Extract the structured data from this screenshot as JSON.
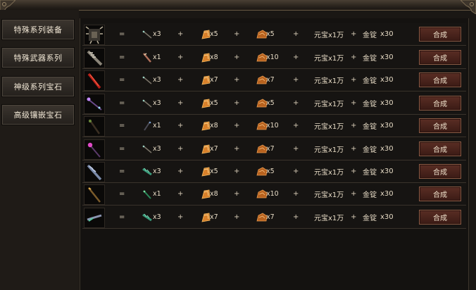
{
  "sidebar": {
    "categories": [
      {
        "label": "特殊系列装备"
      },
      {
        "label": "特殊武器系列"
      },
      {
        "label": "神级系列宝石"
      },
      {
        "label": "高级镶嵌宝石"
      }
    ]
  },
  "recipes": [
    {
      "item_icon": "spiked-armor-icon",
      "equals": "=",
      "mat1_icon": "wand-icon",
      "mat1_qty": "x3",
      "plus1": "+",
      "mat2_icon": "gold-ore-icon",
      "mat2_qty": "x5",
      "plus2": "+",
      "mat3_icon": "copper-ore-icon",
      "mat3_qty": "x5",
      "plus3": "+",
      "yuanbao": "元宝x1万",
      "plus4": "+",
      "gold": "金锭",
      "gold_qty": "x30",
      "button": "合成"
    },
    {
      "item_icon": "heavy-mace-icon",
      "equals": "=",
      "mat1_icon": "short-sword-icon",
      "mat1_qty": "x1",
      "plus1": "+",
      "mat2_icon": "gold-ore-icon",
      "mat2_qty": "x8",
      "plus2": "+",
      "mat3_icon": "copper-ore-icon",
      "mat3_qty": "x10",
      "plus3": "+",
      "yuanbao": "元宝x1万",
      "plus4": "+",
      "gold": "金锭",
      "gold_qty": "x30",
      "button": "合成"
    },
    {
      "item_icon": "red-blade-icon",
      "equals": "=",
      "mat1_icon": "wand-icon",
      "mat1_qty": "x3",
      "plus1": "+",
      "mat2_icon": "gold-ore-icon",
      "mat2_qty": "x7",
      "plus2": "+",
      "mat3_icon": "copper-ore-icon",
      "mat3_qty": "x7",
      "plus3": "+",
      "yuanbao": "元宝x1万",
      "plus4": "+",
      "gold": "金锭",
      "gold_qty": "x30",
      "button": "合成"
    },
    {
      "item_icon": "crystal-staff-icon",
      "equals": "=",
      "mat1_icon": "wand-icon",
      "mat1_qty": "x3",
      "plus1": "+",
      "mat2_icon": "gold-ore-icon",
      "mat2_qty": "x5",
      "plus2": "+",
      "mat3_icon": "copper-ore-icon",
      "mat3_qty": "x5",
      "plus3": "+",
      "yuanbao": "元宝x1万",
      "plus4": "+",
      "gold": "金锭",
      "gold_qty": "x30",
      "button": "合成"
    },
    {
      "item_icon": "dark-spear-icon",
      "equals": "=",
      "mat1_icon": "dark-wand-icon",
      "mat1_qty": "x1",
      "plus1": "+",
      "mat2_icon": "gold-ore-icon",
      "mat2_qty": "x8",
      "plus2": "+",
      "mat3_icon": "copper-ore-icon",
      "mat3_qty": "x10",
      "plus3": "+",
      "yuanbao": "元宝x1万",
      "plus4": "+",
      "gold": "金锭",
      "gold_qty": "x30",
      "button": "合成"
    },
    {
      "item_icon": "pink-orb-staff-icon",
      "equals": "=",
      "mat1_icon": "wand-icon",
      "mat1_qty": "x3",
      "plus1": "+",
      "mat2_icon": "gold-ore-icon",
      "mat2_qty": "x7",
      "plus2": "+",
      "mat3_icon": "copper-ore-icon",
      "mat3_qty": "x7",
      "plus3": "+",
      "yuanbao": "元宝x1万",
      "plus4": "+",
      "gold": "金锭",
      "gold_qty": "x30",
      "button": "合成"
    },
    {
      "item_icon": "blue-halberd-icon",
      "equals": "=",
      "mat1_icon": "green-claw-icon",
      "mat1_qty": "x3",
      "plus1": "+",
      "mat2_icon": "gold-ore-icon",
      "mat2_qty": "x5",
      "plus2": "+",
      "mat3_icon": "copper-ore-icon",
      "mat3_qty": "x5",
      "plus3": "+",
      "yuanbao": "元宝x1万",
      "plus4": "+",
      "gold": "金锭",
      "gold_qty": "x30",
      "button": "合成"
    },
    {
      "item_icon": "golden-spear-icon",
      "equals": "=",
      "mat1_icon": "green-wand-icon",
      "mat1_qty": "x1",
      "plus1": "+",
      "mat2_icon": "gold-ore-icon",
      "mat2_qty": "x8",
      "plus2": "+",
      "mat3_icon": "copper-ore-icon",
      "mat3_qty": "x10",
      "plus3": "+",
      "yuanbao": "元宝x1万",
      "plus4": "+",
      "gold": "金锭",
      "gold_qty": "x30",
      "button": "合成"
    },
    {
      "item_icon": "silver-lance-icon",
      "equals": "=",
      "mat1_icon": "green-claw-icon",
      "mat1_qty": "x3",
      "plus1": "+",
      "mat2_icon": "gold-ore-icon",
      "mat2_qty": "x7",
      "plus2": "+",
      "mat3_icon": "copper-ore-icon",
      "mat3_qty": "x7",
      "plus3": "+",
      "yuanbao": "元宝x1万",
      "plus4": "+",
      "gold": "金锭",
      "gold_qty": "x30",
      "button": "合成"
    }
  ],
  "colors": {
    "gold_ore": "#e08a2a",
    "copper_ore": "#c66a22",
    "button_bg": "#4a231b",
    "row_border": "#3a332b"
  }
}
